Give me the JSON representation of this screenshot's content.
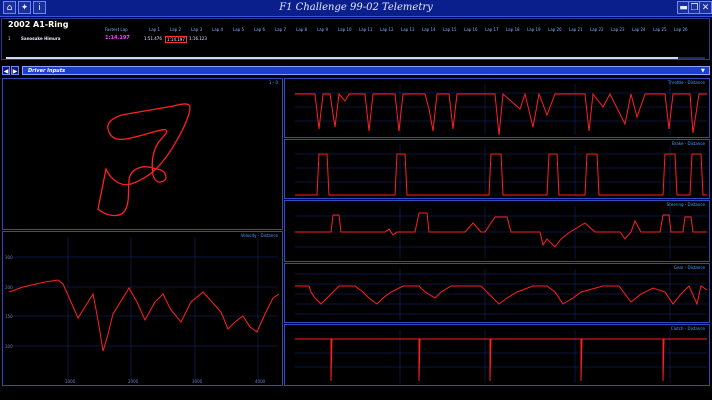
{
  "window": {
    "title": "F1 Challenge 99-02 Telemetry",
    "left_icons": [
      "home-icon",
      "map-pin-icon",
      "info-icon"
    ],
    "right_icons": [
      "minimize-icon",
      "restore-icon",
      "close-icon"
    ]
  },
  "session": {
    "track_title": "2002 A1-Ring",
    "columns": [
      "Fastest Lap",
      "Lap 1",
      "Lap 2",
      "Lap 3",
      "Lap 4",
      "Lap 5",
      "Lap 6",
      "Lap 7",
      "Lap 8",
      "Lap 9",
      "Lap 10",
      "Lap 11",
      "Lap 12",
      "Lap 13",
      "Lap 14",
      "Lap 15",
      "Lap 16",
      "Lap 17",
      "Lap 18",
      "Lap 19",
      "Lap 20",
      "Lap 21",
      "Lap 22",
      "Lap 23",
      "Lap 24",
      "Lap 25",
      "Lap 26"
    ],
    "driver": {
      "pos": "1",
      "name": "Sanosuke Himura",
      "fastest": "1:14.197",
      "laps": [
        "1:51.476",
        "1:14.197",
        "1:16.123"
      ]
    }
  },
  "inputs": {
    "selected": "Driver Inputs"
  },
  "panels": {
    "map": {
      "label": "1 - 0"
    },
    "velocity": {
      "label": "Velocity - Distance"
    },
    "throttle": {
      "label": "Throttle - Distance"
    },
    "brake": {
      "label": "Brake - Distance"
    },
    "steering": {
      "label": "Steering - Distance"
    },
    "gear": {
      "label": "Gear - Distance"
    },
    "clutch": {
      "label": "Clutch - Distance"
    }
  },
  "colors": {
    "trace": "#ff2020",
    "grid": "#1a2a7a",
    "panel_border": "#2f4bbf",
    "label": "#4f9cff",
    "fastest": "#ff3cff"
  }
}
